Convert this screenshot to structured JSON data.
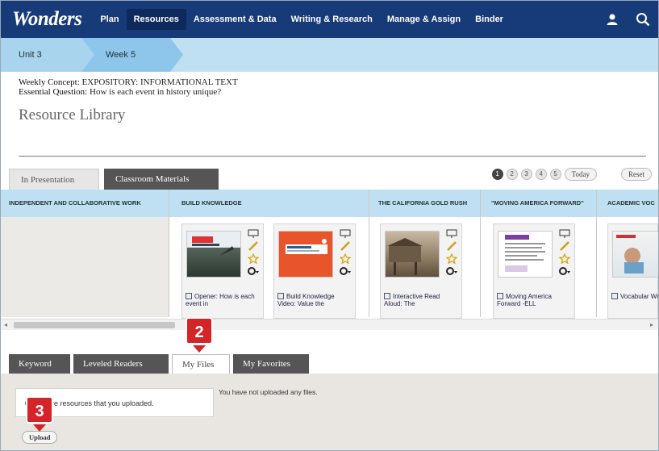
{
  "app": {
    "logo": "Wonders"
  },
  "nav": {
    "items": [
      {
        "label": "Plan"
      },
      {
        "label": "Resources",
        "active": true
      },
      {
        "label": "Assessment & Data"
      },
      {
        "label": "Writing & Research"
      },
      {
        "label": "Manage & Assign"
      },
      {
        "label": "Binder"
      }
    ],
    "icons": [
      "user-icon",
      "search-icon"
    ]
  },
  "breadcrumb": {
    "unit": "Unit 3",
    "week": "Week 5"
  },
  "concept": {
    "weekly_label": "Weekly Concept:",
    "weekly_value": "EXPOSITORY: INFORMATIONAL TEXT",
    "question_label": "Essential Question:",
    "question_value": "How is each event in history unique?"
  },
  "page_title": "Resource Library",
  "top_tabs": [
    {
      "label": "In Presentation",
      "active": true
    },
    {
      "label": "Classroom Materials",
      "active": false
    }
  ],
  "pager": {
    "pages": [
      "1",
      "2",
      "3",
      "4",
      "5"
    ],
    "current": "1",
    "today_label": "Today",
    "reset_label": "Reset"
  },
  "columns": [
    "INDEPENDENT AND COLLABORATIVE WORK",
    "BUILD KNOWLEDGE",
    "THE CALIFORNIA GOLD RUSH",
    "\"MOVING AMERICA FORWARD\"",
    "ACADEMIC VOC"
  ],
  "cards": [
    {
      "caption": "Opener: How is each event in",
      "thumb": "photo-dark"
    },
    {
      "caption": "Build Knowledge Video: Value the",
      "thumb": "orange-slide"
    },
    {
      "caption": "Interactive Read Aloud: The",
      "thumb": "sepia-photo"
    },
    {
      "caption": "Moving America Forward -ELL",
      "thumb": "doc-page"
    },
    {
      "caption": "Vocabular Words Lin",
      "thumb": "child-photo"
    }
  ],
  "bottom_tabs": [
    {
      "label": "Keyword",
      "active": false
    },
    {
      "label": "Leveled Readers",
      "active": false
    },
    {
      "label": "My Files",
      "active": true
    },
    {
      "label": "My Favorites",
      "active": false
    }
  ],
  "my_files": {
    "info_text": "s are resources that you uploaded.",
    "empty_text": "You have not uploaded any files.",
    "upload_label": "Upload"
  },
  "callouts": [
    "2",
    "3"
  ],
  "colors": {
    "nav_bg": "#173a78",
    "light_blue": "#bfe0f3",
    "callout_red": "#d3242a"
  }
}
